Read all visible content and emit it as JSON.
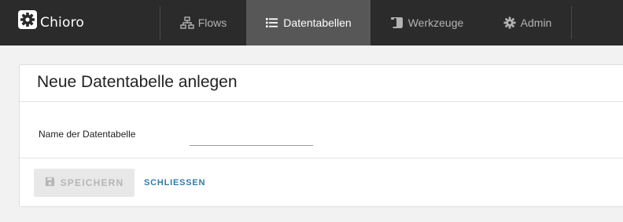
{
  "navbar": {
    "brand": {
      "name": "Chioro",
      "icon": "gear-logo-icon"
    },
    "items": [
      {
        "label": "Flows",
        "icon": "sitemap-icon",
        "active": false
      },
      {
        "label": "Datentabellen",
        "icon": "list-icon",
        "active": true
      },
      {
        "label": "Werkzeuge",
        "icon": "scroll-icon",
        "active": false
      },
      {
        "label": "Admin",
        "icon": "gear-icon",
        "active": false
      }
    ]
  },
  "dialog": {
    "title": "Neue Datentabelle anlegen",
    "name_field": {
      "label": "Name der Datentabelle",
      "value": "",
      "placeholder": ""
    },
    "buttons": {
      "save_label": "SPEICHERN",
      "save_icon": "floppy-disk-icon",
      "save_disabled": true,
      "close_label": "SCHLIESSEN"
    }
  },
  "colors": {
    "navbar_bg": "#2b2b2b",
    "nav_active_bg": "#575757",
    "link_blue": "#337aa6",
    "page_bg": "#f2f2f2"
  }
}
